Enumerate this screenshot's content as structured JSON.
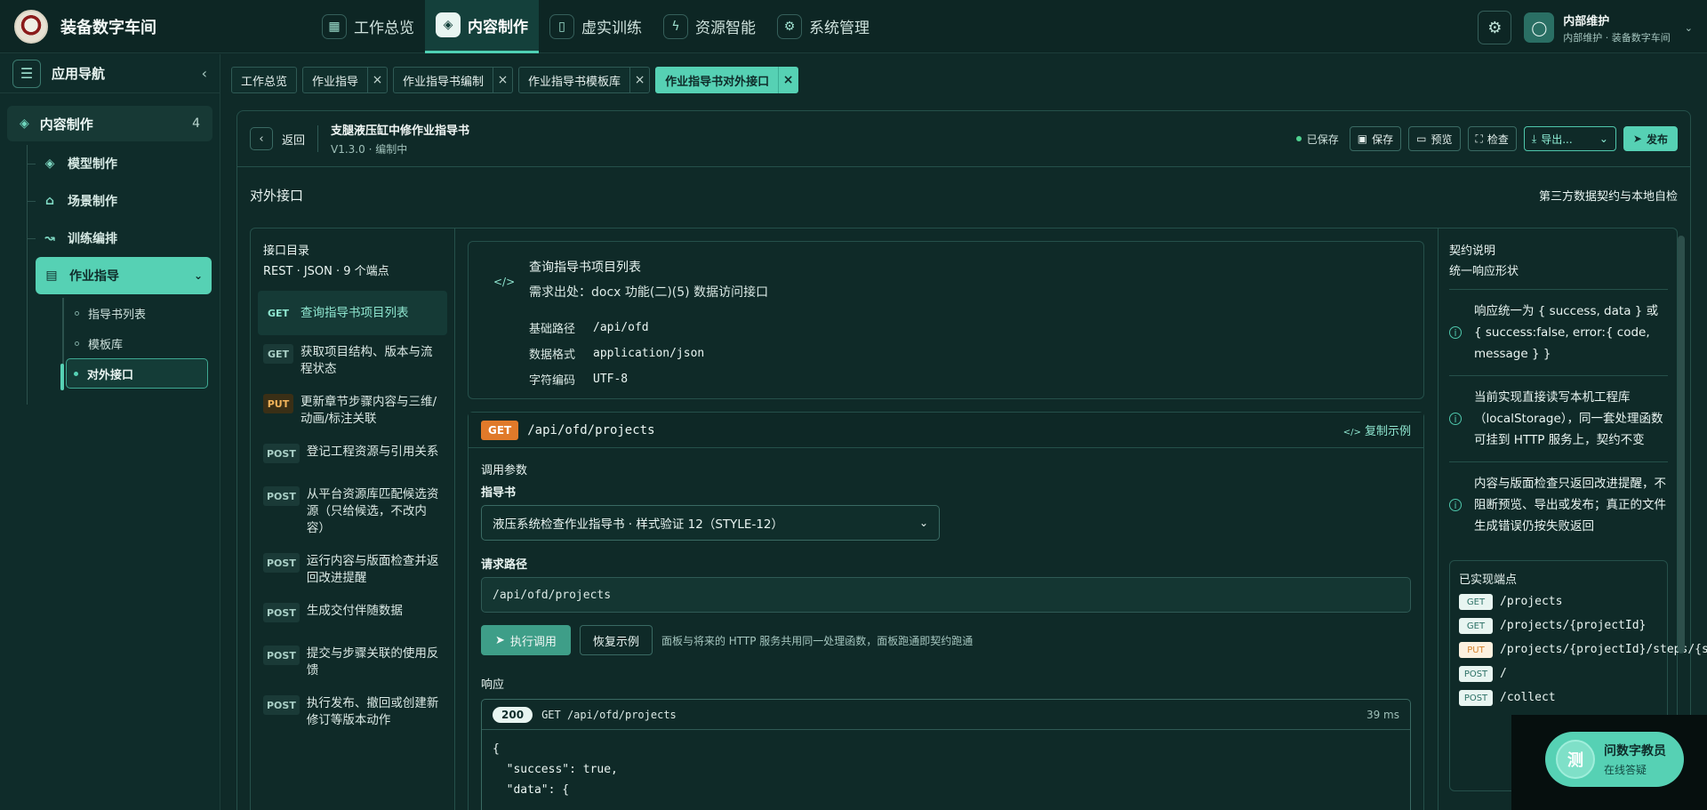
{
  "brand": {
    "title": "装备数字车间"
  },
  "nav": [
    {
      "label": "工作总览",
      "icon": "grid-icon",
      "glyph": "▦",
      "active": false
    },
    {
      "label": "内容制作",
      "icon": "cube-icon",
      "glyph": "◈",
      "active": true
    },
    {
      "label": "虚实训练",
      "icon": "book-icon",
      "glyph": "▯",
      "active": false
    },
    {
      "label": "资源智能",
      "icon": "plug-icon",
      "glyph": "ϟ",
      "active": false
    },
    {
      "label": "系统管理",
      "icon": "gear-icon",
      "glyph": "⚙",
      "active": false
    }
  ],
  "user": {
    "name": "内部维护",
    "sub": "内部维护 · 装备数字车间"
  },
  "sidebar": {
    "title": "应用导航",
    "group": {
      "label": "内容制作",
      "count": "4"
    },
    "items": [
      {
        "label": "模型制作",
        "icon": "cube-icon",
        "glyph": "◈"
      },
      {
        "label": "场景制作",
        "icon": "bank-icon",
        "glyph": "⌂"
      },
      {
        "label": "训练编排",
        "icon": "route-icon",
        "glyph": "↝"
      },
      {
        "label": "作业指导",
        "icon": "document-icon",
        "glyph": "▤"
      }
    ],
    "sub_items": [
      {
        "label": "指导书列表"
      },
      {
        "label": "模板库"
      },
      {
        "label": "对外接口"
      }
    ]
  },
  "tabs": [
    {
      "label": "工作总览",
      "closable": false
    },
    {
      "label": "作业指导",
      "closable": true
    },
    {
      "label": "作业指导书编制",
      "closable": true
    },
    {
      "label": "作业指导书模板库",
      "closable": true
    },
    {
      "label": "作业指导书对外接口",
      "closable": true,
      "active": true
    }
  ],
  "editor": {
    "back_label": "返回",
    "doc_title": "支腿液压缸中修作业指导书",
    "doc_sub": "V1.3.0 · 编制中",
    "saved_label": "已保存",
    "save_label": "保存",
    "preview_label": "预览",
    "check_label": "检查",
    "export_label": "导出...",
    "publish_label": "发布"
  },
  "section": {
    "title": "对外接口",
    "right": "第三方数据契约与本地自检"
  },
  "directory": {
    "title": "接口目录",
    "sub": "REST · JSON · 9 个端点",
    "endpoints": [
      {
        "method": "GET",
        "label": "查询指导书项目列表"
      },
      {
        "method": "GET",
        "label": "获取项目结构、版本与流程状态"
      },
      {
        "method": "PUT",
        "label": "更新章节步骤内容与三维/动画/标注关联"
      },
      {
        "method": "POST",
        "label": "登记工程资源与引用关系"
      },
      {
        "method": "POST",
        "label": "从平台资源库匹配候选资源（只给候选，不改内容）"
      },
      {
        "method": "POST",
        "label": "运行内容与版面检查并返回改进提醒"
      },
      {
        "method": "POST",
        "label": "生成交付伴随数据"
      },
      {
        "method": "POST",
        "label": "提交与步骤关联的使用反馈"
      },
      {
        "method": "POST",
        "label": "执行发布、撤回或创建新修订等版本动作"
      }
    ]
  },
  "info": {
    "title": "查询指导书项目列表",
    "source": "需求出处：docx 功能(二)(5) 数据访问接口",
    "rows": [
      {
        "key": "基础路径",
        "value": "/api/ofd"
      },
      {
        "key": "数据格式",
        "value": "application/json"
      },
      {
        "key": "字符编码",
        "value": "UTF-8"
      }
    ]
  },
  "request": {
    "method": "GET",
    "path": "/api/ofd/projects",
    "copy_label": "复制示例",
    "params_label": "调用参数",
    "doc_label": "指导书",
    "doc_selected": "液压系统检查作业指导书 · 样式验证 12（STYLE-12）",
    "path_label": "请求路径",
    "path_value": "/api/ofd/projects",
    "run_label": "执行调用",
    "reset_label": "恢复示例",
    "note": "面板与将来的 HTTP 服务共用同一处理函数，面板跑通即契约跑通",
    "response_label": "响应",
    "status": "200",
    "resp_req": "GET /api/ofd/projects",
    "resp_ms": "39 ms",
    "resp_code": "{\n  \"success\": true,\n  \"data\": {"
  },
  "contract": {
    "title": "契约说明",
    "sub": "统一响应形状",
    "notes": [
      "响应统一为 { success, data } 或 { success:false, error:{ code, message } }",
      "当前实现直接读写本机工程库（localStorage），同一套处理函数可挂到 HTTP 服务上，契约不变",
      "内容与版面检查只返回改进提醒，不阻断预览、导出或发布；真正的文件生成错误仍按失败返回"
    ],
    "impl_title": "已实现端点",
    "impl": [
      {
        "method": "GET",
        "path": "/projects"
      },
      {
        "method": "GET",
        "path": "/projects/{projectId}"
      },
      {
        "method": "PUT",
        "path": "/projects/{projectId}/steps/{stepId}"
      },
      {
        "method": "POST",
        "path": "/"
      },
      {
        "method": "POST",
        "path": "/collect"
      }
    ]
  },
  "helper": {
    "avatar": "测",
    "title": "问数字教员",
    "sub": "在线答疑"
  }
}
